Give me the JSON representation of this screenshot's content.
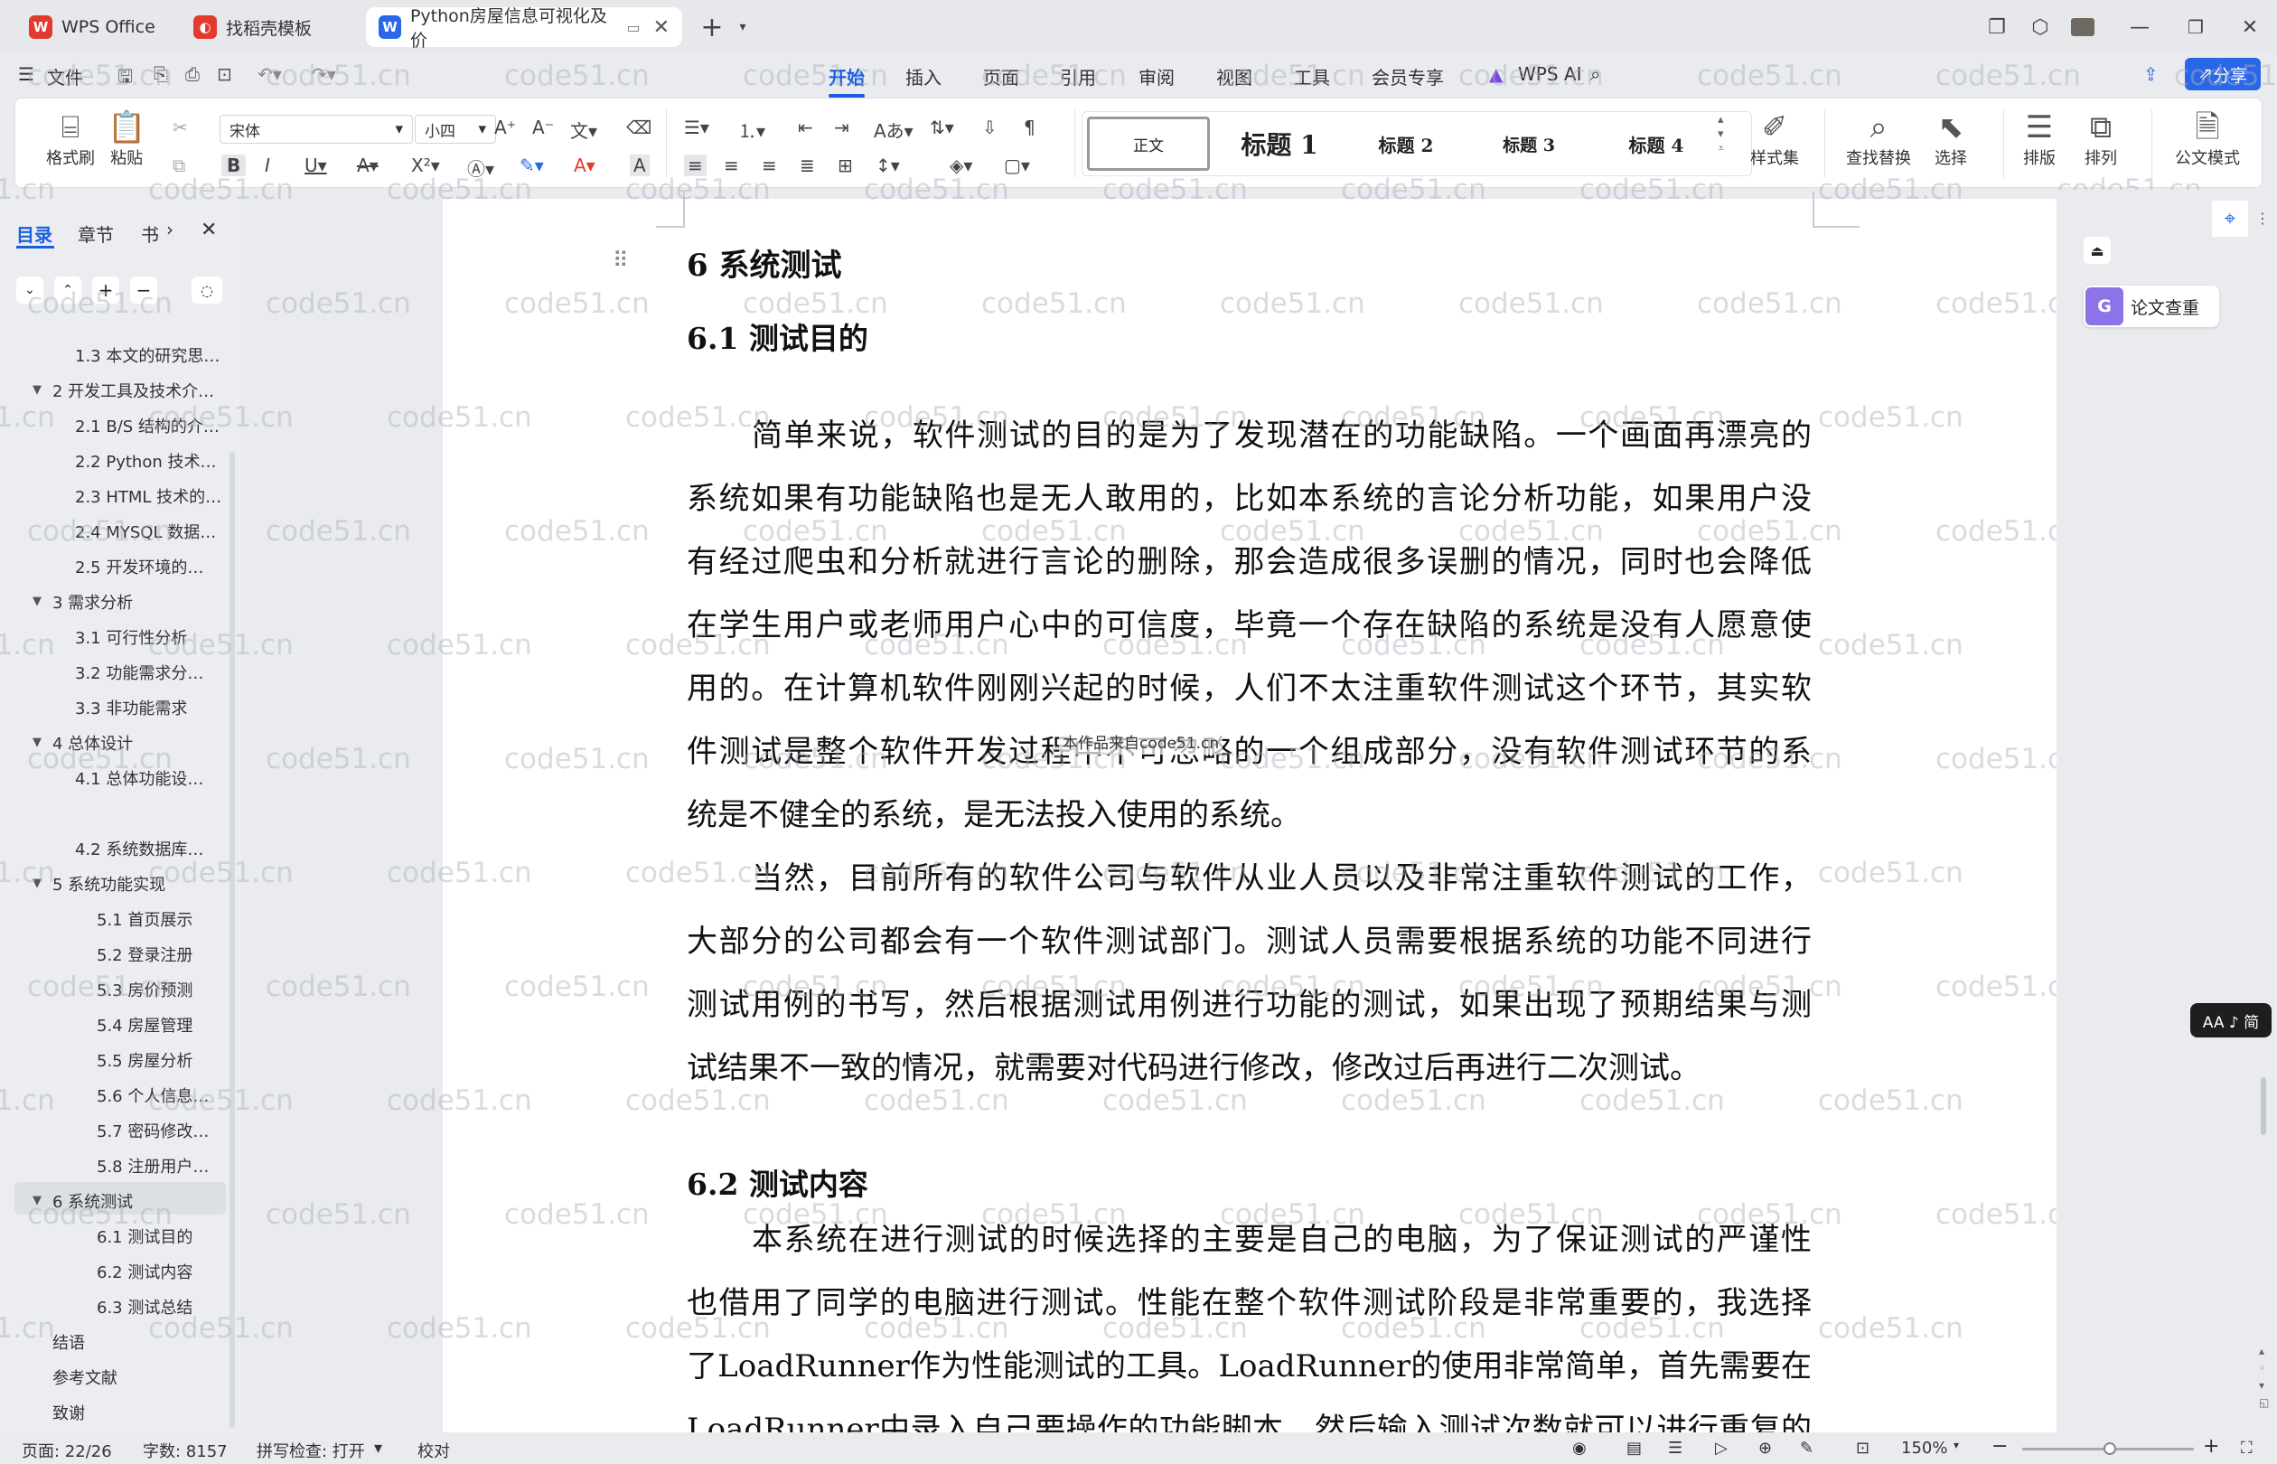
{
  "tabs": [
    {
      "label": "WPS Office"
    },
    {
      "label": "找稻壳模板"
    },
    {
      "label": "Python房屋信息可视化及价"
    }
  ],
  "menu": {
    "file": "文件",
    "items": [
      "开始",
      "插入",
      "页面",
      "引用",
      "审阅",
      "视图",
      "工具",
      "会员专享"
    ],
    "wps_ai": "WPS AI",
    "share": "分享"
  },
  "ribbon": {
    "format_painter": "格式刷",
    "paste": "粘贴",
    "font": "宋体",
    "size": "小四",
    "styles": [
      "正文",
      "标题 1",
      "标题 2",
      "标题 3",
      "标题 4"
    ],
    "style_set": "样式集",
    "find_replace": "查找替换",
    "select": "选择",
    "typeset": "排版",
    "arrange": "排列",
    "official": "公文模式"
  },
  "sidebar": {
    "tabs": [
      "目录",
      "章节",
      "书"
    ],
    "items": [
      {
        "label": "1.3 本文的研究思…",
        "level": 2
      },
      {
        "label": "2 开发工具及技术介…",
        "level": 1
      },
      {
        "label": "2.1 B/S 结构的介…",
        "level": 2
      },
      {
        "label": "2.2 Python 技术…",
        "level": 2
      },
      {
        "label": "2.3 HTML 技术的…",
        "level": 2
      },
      {
        "label": "2.4 MYSQL 数据…",
        "level": 2
      },
      {
        "label": "2.5  开发环境的…",
        "level": 2
      },
      {
        "label": "3  需求分析",
        "level": 1
      },
      {
        "label": "3.1  可行性分析",
        "level": 2
      },
      {
        "label": "3.2  功能需求分…",
        "level": 2
      },
      {
        "label": "3.3  非功能需求",
        "level": 2
      },
      {
        "label": "4  总体设计",
        "level": 1
      },
      {
        "label": "4.1  总体功能设…",
        "level": 2
      },
      {
        "label": "4.2  系统数据库…",
        "level": 2
      },
      {
        "label": "5  系统功能实现",
        "level": 1
      },
      {
        "label": "5.1  首页展示",
        "level": 3
      },
      {
        "label": "5.2  登录注册",
        "level": 3
      },
      {
        "label": "5.3  房价预测",
        "level": 3
      },
      {
        "label": "5.4  房屋管理",
        "level": 3
      },
      {
        "label": "5.5  房屋分析",
        "level": 3
      },
      {
        "label": "5.6  个人信息…",
        "level": 3
      },
      {
        "label": "5.7  密码修改…",
        "level": 3
      },
      {
        "label": "5.8  注册用户…",
        "level": 3
      },
      {
        "label": "6  系统测试",
        "level": 1
      },
      {
        "label": "6.1  测试目的",
        "level": 3
      },
      {
        "label": "6.2  测试内容",
        "level": 3
      },
      {
        "label": "6.3  测试总结",
        "level": 3
      },
      {
        "label": "结语",
        "level": 0
      },
      {
        "label": "参考文献",
        "level": 0
      },
      {
        "label": "致谢",
        "level": 0
      }
    ]
  },
  "doc": {
    "h1": "6  系统测试",
    "h2a": "6.1  测试目的",
    "p1": [
      "简单来说，软件测试的目的是为了发现潜在的功能缺陷。一个画面再漂亮的",
      "系统如果有功能缺陷也是无人敢用的，比如本系统的言论分析功能，如果用户没",
      "有经过爬虫和分析就进行言论的删除，那会造成很多误删的情况，同时也会降低",
      "在学生用户或老师用户心中的可信度，毕竟一个存在缺陷的系统是没有人愿意使",
      "用的。在计算机软件刚刚兴起的时候，人们不太注重软件测试这个环节，其实软",
      "件测试是整个软件开发过程中不可忽略的一个组成部分，没有软件测试环节的系",
      "统是不健全的系统，是无法投入使用的系统。"
    ],
    "p2": [
      "当然，目前所有的软件公司与软件从业人员以及非常注重软件测试的工作，",
      "大部分的公司都会有一个软件测试部门。测试人员需要根据系统的功能不同进行",
      "测试用例的书写，然后根据测试用例进行功能的测试，如果出现了预期结果与测",
      "试结果不一致的情况，就需要对代码进行修改，修改过后再进行二次测试。"
    ],
    "h2b": "6.2  测试内容",
    "p3": [
      "本系统在进行测试的时候选择的主要是自己的电脑，为了保证测试的严谨性",
      "也借用了同学的电脑进行测试。性能在整个软件测试阶段是非常重要的，我选择",
      "了LoadRunner作为性能测试的工具。LoadRunner的使用非常简单，首先需要在",
      "LoadRunner中录入自己要操作的功能脚本，然后输入测试次数就可以进行重复的"
    ],
    "tooltip": "本作品来自code51.cn",
    "watermark": "code51.cn"
  },
  "right_panel": {
    "plagiarism": "论文查重",
    "font_toggle": "AA ♪ 简"
  },
  "status": {
    "page": "页面: 22/26",
    "words": "字数: 8157",
    "spell": "拼写检查: 打开",
    "proof": "校对",
    "zoom": "150%"
  },
  "colors": {
    "accent": "#1a5fe0",
    "wps_red": "#e33a2f",
    "heading": "#111111"
  }
}
